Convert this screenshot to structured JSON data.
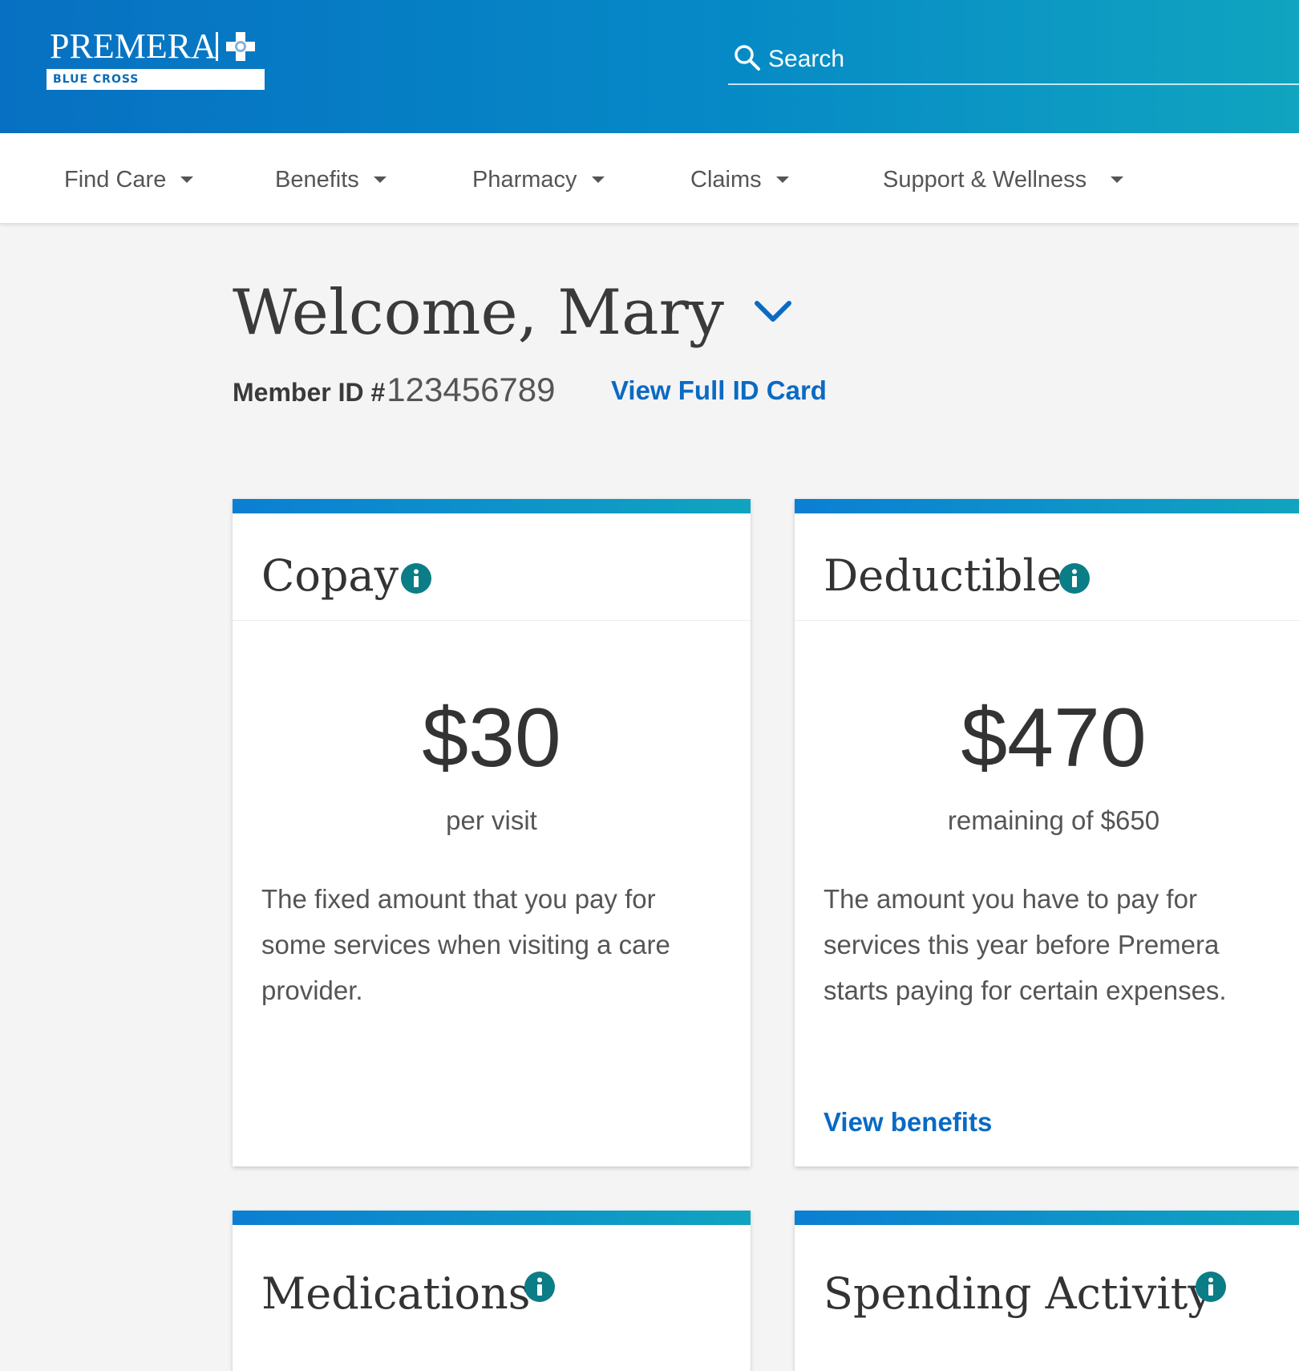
{
  "brand": {
    "name": "PREMERA",
    "subtitle": "BLUE CROSS"
  },
  "search": {
    "placeholder": "Search"
  },
  "nav": {
    "items": [
      {
        "label": "Find Care"
      },
      {
        "label": "Benefits"
      },
      {
        "label": "Pharmacy"
      },
      {
        "label": "Claims"
      },
      {
        "label": "Support & Wellness"
      }
    ]
  },
  "welcome": {
    "greeting": "Welcome, Mary",
    "member_label": "Member ID #",
    "member_id": "123456789",
    "id_card_link": "View Full ID Card"
  },
  "cards": [
    {
      "title": "Copay",
      "value": "$30",
      "sub": "per visit",
      "desc": "The fixed amount that you pay for some services when visiting a care provider.",
      "link": ""
    },
    {
      "title": "Deductible",
      "value": "$470",
      "sub": "remaining of $650",
      "desc": "The amount you have to pay for services this year before Premera starts paying for certain expenses.",
      "link": "View benefits"
    },
    {
      "title": "Medications"
    },
    {
      "title": "Spending Activity"
    }
  ],
  "colors": {
    "header_start": "#0770c2",
    "header_end": "#10a4c0",
    "link": "#0a6ac4",
    "info_icon": "#0b7d86"
  }
}
